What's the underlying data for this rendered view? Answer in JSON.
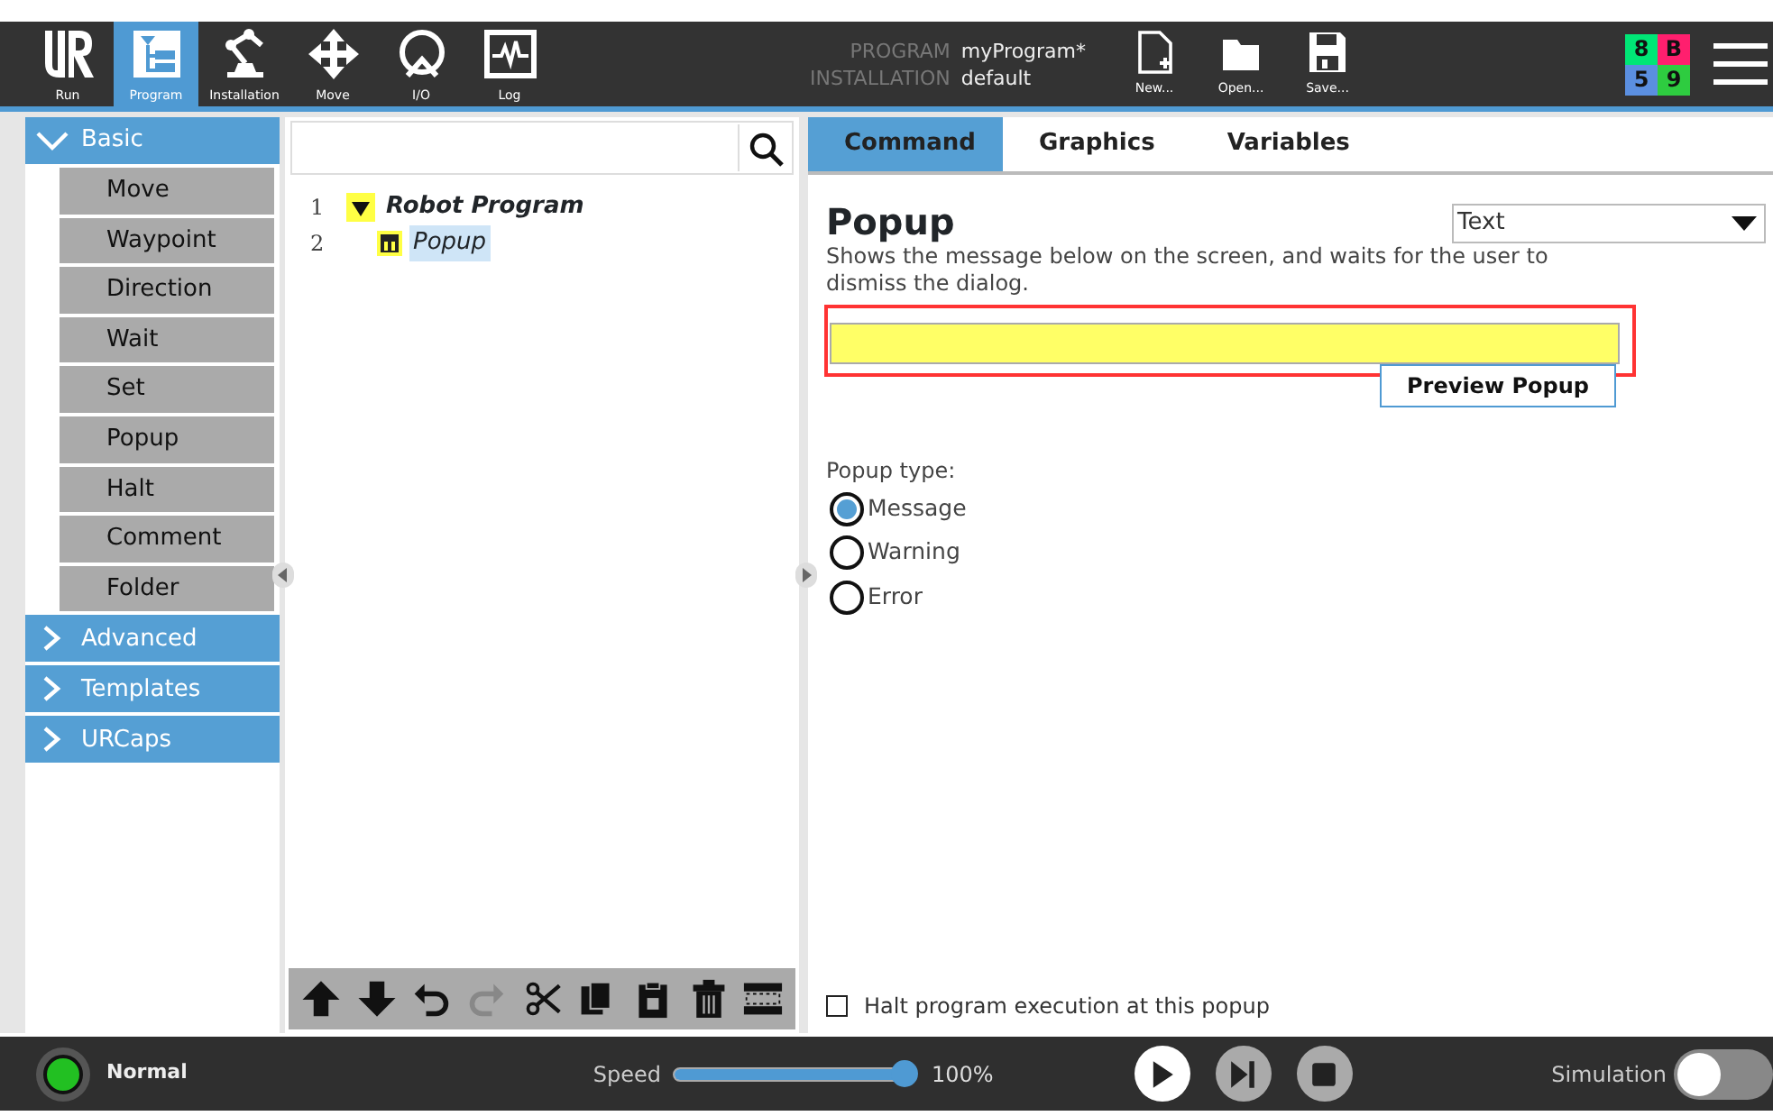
{
  "header": {
    "nav": [
      {
        "label": "Run",
        "kind": "run",
        "selected": false
      },
      {
        "label": "Program",
        "kind": "program",
        "selected": true
      },
      {
        "label": "Installation",
        "kind": "installation",
        "selected": false
      },
      {
        "label": "Move",
        "kind": "move",
        "selected": false
      },
      {
        "label": "I/O",
        "kind": "io",
        "selected": false
      },
      {
        "label": "Log",
        "kind": "log",
        "selected": false
      }
    ],
    "program_label": "PROGRAM",
    "program_name": "myProgram*",
    "installation_label": "INSTALLATION",
    "installation_name": "default",
    "file_buttons": [
      {
        "label": "New...",
        "kind": "new"
      },
      {
        "label": "Open...",
        "kind": "open"
      },
      {
        "label": "Save...",
        "kind": "save"
      }
    ],
    "status_grid": [
      {
        "text": "8",
        "color": "#00e676"
      },
      {
        "text": "B",
        "color": "#ff1f6e"
      },
      {
        "text": "5",
        "color": "#5b8fe0"
      },
      {
        "text": "9",
        "color": "#2ecc40"
      }
    ]
  },
  "sidebar": {
    "sections": [
      {
        "label": "Basic",
        "expanded": true,
        "items": [
          "Move",
          "Waypoint",
          "Direction",
          "Wait",
          "Set",
          "Popup",
          "Halt",
          "Comment",
          "Folder"
        ]
      },
      {
        "label": "Advanced",
        "expanded": false
      },
      {
        "label": "Templates",
        "expanded": false
      },
      {
        "label": "URCaps",
        "expanded": false
      }
    ]
  },
  "tree": {
    "nodes": [
      {
        "line": "1",
        "label": "Robot Program",
        "kind": "root",
        "selected": false,
        "children": [
          {
            "line": "2",
            "label": "Popup",
            "kind": "popup",
            "selected": true
          }
        ]
      }
    ],
    "toolbar": [
      {
        "kind": "up",
        "disabled": false
      },
      {
        "kind": "down",
        "disabled": false
      },
      {
        "kind": "undo",
        "disabled": false
      },
      {
        "kind": "redo",
        "disabled": true
      },
      {
        "kind": "cut",
        "disabled": false
      },
      {
        "kind": "copy",
        "disabled": false
      },
      {
        "kind": "paste",
        "disabled": false
      },
      {
        "kind": "delete",
        "disabled": false
      },
      {
        "kind": "suppress",
        "disabled": false
      }
    ]
  },
  "tabs": [
    {
      "label": "Command",
      "selected": true
    },
    {
      "label": "Graphics",
      "selected": false
    },
    {
      "label": "Variables",
      "selected": false
    }
  ],
  "command": {
    "title": "Popup",
    "description": "Shows the message below on the screen, and waits for the user to dismiss the dialog.",
    "mode_select": "Text",
    "message_field": {
      "highlighted": true
    },
    "preview_button": "Preview Popup",
    "popup_type_label": "Popup type:",
    "popup_types": [
      {
        "label": "Message",
        "selected": true
      },
      {
        "label": "Warning",
        "selected": false
      },
      {
        "label": "Error",
        "selected": false
      }
    ],
    "halt_option": {
      "label": "Halt program execution at this popup",
      "checked": false
    }
  },
  "footer": {
    "robot_state": "Normal",
    "speed_label": "Speed",
    "speed": {
      "level": 1.0
    },
    "speed_reading": "100%",
    "simulation_label": "Simulation",
    "simulation": {
      "on": false
    }
  }
}
